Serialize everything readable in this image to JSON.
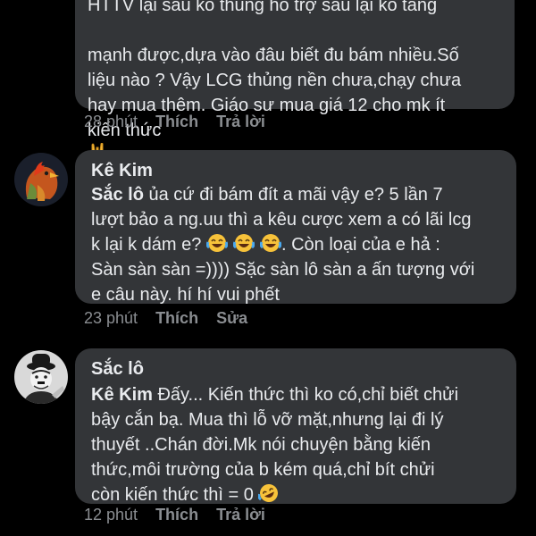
{
  "comment1": {
    "text_line0": "HTTV lại sau ko thủng hỗ trợ sau lại ko tăng",
    "text": "mạnh được,dựa vào đâu biết đu bám nhiều.Số\nliệu nào ? Vậy LCG thủng nền chưa,chạy chưa\nhay mua thêm. Giáo sư mua giá 12 cho mk ít\nkiến thức",
    "emoji": "rock-on-hand",
    "time": "28 phút",
    "like": "Thích",
    "reply": "Trả lời"
  },
  "comment2": {
    "author": "Kê Kim",
    "mention": "Sắc lô",
    "text_a": " ủa cứ đi bám đít a mãi vậy e? 5 lần 7\nlượt bảo a ng.uu thì a kêu cược xem a có lãi lcg\nk lại k dám e? ",
    "text_b": ". Còn loại của e hả :\nSàn sàn sàn =)))) Sặc sàn lô sàn a ấn tượng với\ne câu này. hí hí vui phết",
    "emoji": "laughing-tears-x3",
    "time": "23 phút",
    "like": "Thích",
    "edit": "Sửa"
  },
  "comment3": {
    "author": "Sắc lô",
    "mention": "Kê Kim",
    "text": "  Đấy... Kiến thức thì ko có,chỉ biết chửi\nbậy cắn bạ. Mua thì lỗ vỡ mặt,nhưng lại đi lý\nthuyết ..Chán đời.Mk nói chuyện bằng kiến\nthức,môi trường của b kém quá,chỉ bít chửi\ncòn kiến thức thì = 0 ",
    "emoji": "rolling-laughing",
    "time": "12 phút",
    "like": "Thích",
    "reply": "Trả lời"
  },
  "colors": {
    "background": "#000000",
    "bubble": "#333538",
    "text": "#e9ebee",
    "meta": "#8a8d91"
  }
}
